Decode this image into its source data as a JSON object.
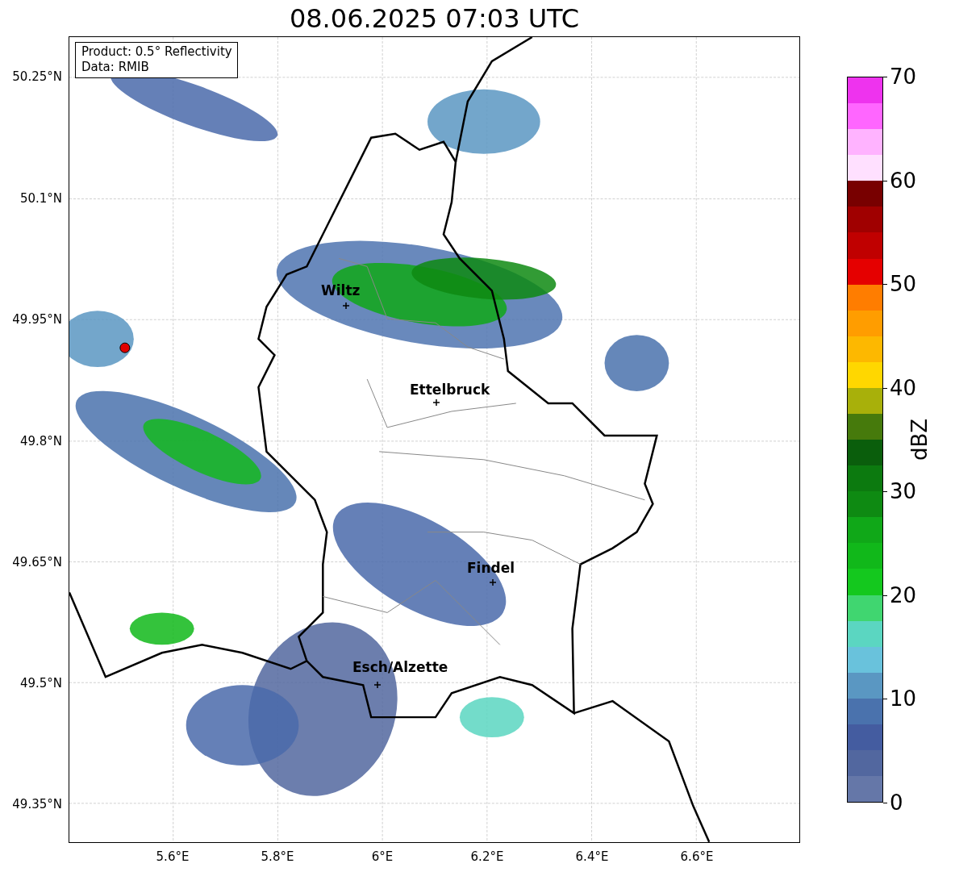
{
  "title": "08.06.2025 07:03 UTC",
  "info_box": [
    "Product: 0.5° Reflectivity",
    "Data: RMIB"
  ],
  "map": {
    "cities": [
      {
        "name": "Wiltz"
      },
      {
        "name": "Ettelbruck"
      },
      {
        "name": "Findel"
      },
      {
        "name": "Esch/Alzette"
      }
    ],
    "lat_labels": [
      "50.25°N",
      "50.1°N",
      "49.95°N",
      "49.8°N",
      "49.65°N",
      "49.5°N",
      "49.35°N"
    ],
    "lon_labels": [
      "5.6°E",
      "5.8°E",
      "6°E",
      "6.2°E",
      "6.4°E",
      "6.6°E"
    ]
  },
  "colorbar": {
    "label": "dBZ",
    "ticks": [
      "70",
      "60",
      "50",
      "40",
      "30",
      "20",
      "10",
      "0"
    ],
    "segments": [
      {
        "color": "#ee33ee"
      },
      {
        "color": "#ff66ff"
      },
      {
        "color": "#ffb3ff"
      },
      {
        "color": "#ffe0ff"
      },
      {
        "color": "#780000"
      },
      {
        "color": "#a00000"
      },
      {
        "color": "#c00000"
      },
      {
        "color": "#e50000"
      },
      {
        "color": "#ff7d00"
      },
      {
        "color": "#ff9d00"
      },
      {
        "color": "#fdb800"
      },
      {
        "color": "#ffd700"
      },
      {
        "color": "#a8b00a"
      },
      {
        "color": "#467a0c"
      },
      {
        "color": "#0a5e0c"
      },
      {
        "color": "#0c7a0f"
      },
      {
        "color": "#0e8a12"
      },
      {
        "color": "#10a818"
      },
      {
        "color": "#11b81a"
      },
      {
        "color": "#14c81e"
      },
      {
        "color": "#40d670"
      },
      {
        "color": "#5bd6c1"
      },
      {
        "color": "#69c2dc"
      },
      {
        "color": "#5a97c2"
      },
      {
        "color": "#4a72ad"
      },
      {
        "color": "#445ca0"
      },
      {
        "color": "#52679f"
      },
      {
        "color": "#6577a8"
      }
    ]
  }
}
